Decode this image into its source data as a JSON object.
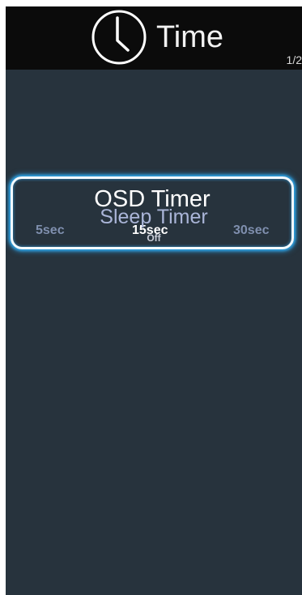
{
  "header": {
    "icon": "clock-icon",
    "title": "Time",
    "page_indicator": "1/2"
  },
  "menu": {
    "items": [
      {
        "label": "OSD Timer",
        "selected": true,
        "options": [
          "5sec",
          "15sec",
          "30sec"
        ],
        "current_value": "15sec"
      },
      {
        "label": "Sleep Timer",
        "selected": false,
        "value": "Off"
      }
    ]
  },
  "colors": {
    "background": "#27333d",
    "header_background": "#0b0b0b",
    "selection_glow": "#2fa6e8",
    "inactive_option": "#7f8fae",
    "active_option": "#ffffff"
  }
}
